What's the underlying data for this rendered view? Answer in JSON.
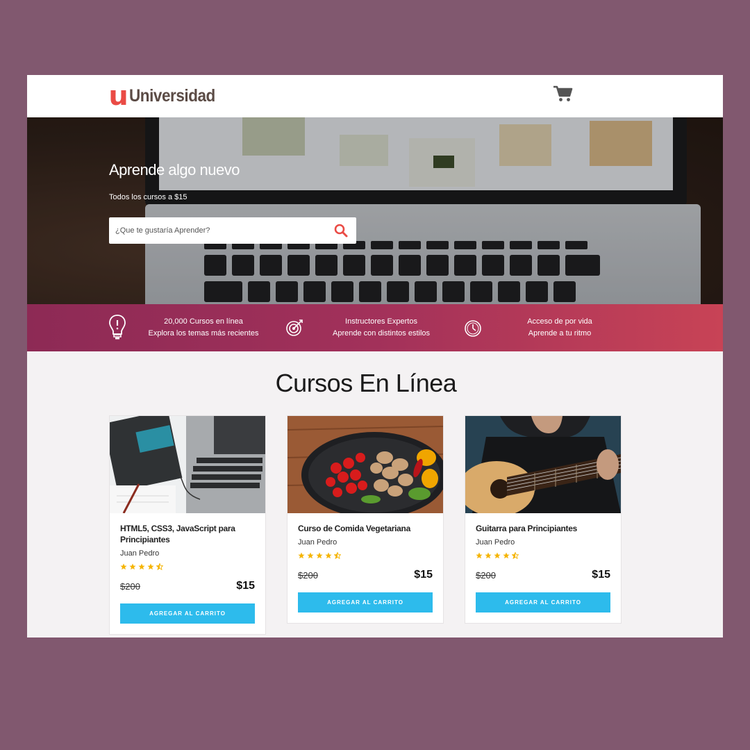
{
  "header": {
    "logo_mark": "u",
    "logo_text": "Universidad",
    "cart_icon": "shopping-cart-icon"
  },
  "hero": {
    "title": "Aprende algo nuevo",
    "subtitle": "Todos los cursos a $15",
    "search_placeholder": "¿Que te gustaría Aprender?",
    "search_icon": "search-icon"
  },
  "features": [
    {
      "icon": "lightbulb-icon",
      "line1": "20,000 Cursos en línea",
      "line2": "Explora los temas más recientes"
    },
    {
      "icon": "target-icon",
      "line1": "Instructores Expertos",
      "line2": "Aprende con distintos estilos"
    },
    {
      "icon": "clock-icon",
      "line1": "Acceso de por vida",
      "line2": "Aprende a tu ritmo"
    }
  ],
  "section": {
    "title": "Cursos En Línea"
  },
  "courses": [
    {
      "title": "HTML5, CSS3, JavaScript para Principiantes",
      "author": "Juan Pedro",
      "rating": 4.5,
      "old_price": "$200",
      "price": "$15",
      "button": "AGREGAR AL CARRITO",
      "image": "laptop-notebook-photo"
    },
    {
      "title": "Curso de Comida Vegetariana",
      "author": "Juan Pedro",
      "rating": 4.5,
      "old_price": "$200",
      "price": "$15",
      "button": "AGREGAR AL CARRITO",
      "image": "vegetables-pan-photo"
    },
    {
      "title": "Guitarra para Principiantes",
      "author": "Juan Pedro",
      "rating": 4.5,
      "old_price": "$200",
      "price": "$15",
      "button": "AGREGAR AL CARRITO",
      "image": "guitar-player-photo"
    }
  ],
  "colors": {
    "accent_red": "#ea4b45",
    "button_blue": "#2dbbec",
    "star_gold": "#f5b400",
    "band_start": "#8d2a55",
    "band_end": "#c84356"
  }
}
